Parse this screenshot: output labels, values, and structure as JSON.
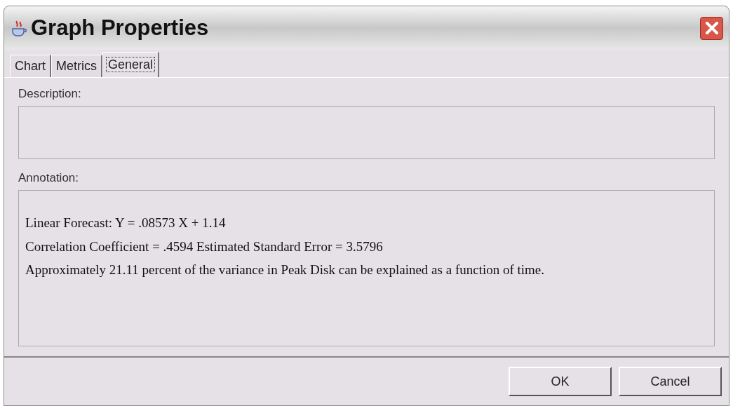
{
  "window": {
    "title": "Graph Properties"
  },
  "tabs": [
    {
      "label": "Chart",
      "selected": false
    },
    {
      "label": "Metrics",
      "selected": false
    },
    {
      "label": "General",
      "selected": true
    }
  ],
  "description": {
    "label": "Description:"
  },
  "annotation": {
    "label": "Annotation:",
    "lines": [
      "Linear Forecast: Y = .08573 X + 1.14",
      "Correlation Coefficient = .4594 Estimated Standard Error = 3.5796",
      "Approximately 21.11 percent of the variance in Peak Disk can be explained as a function of time."
    ]
  },
  "buttons": [
    "OK",
    "Cancel"
  ]
}
